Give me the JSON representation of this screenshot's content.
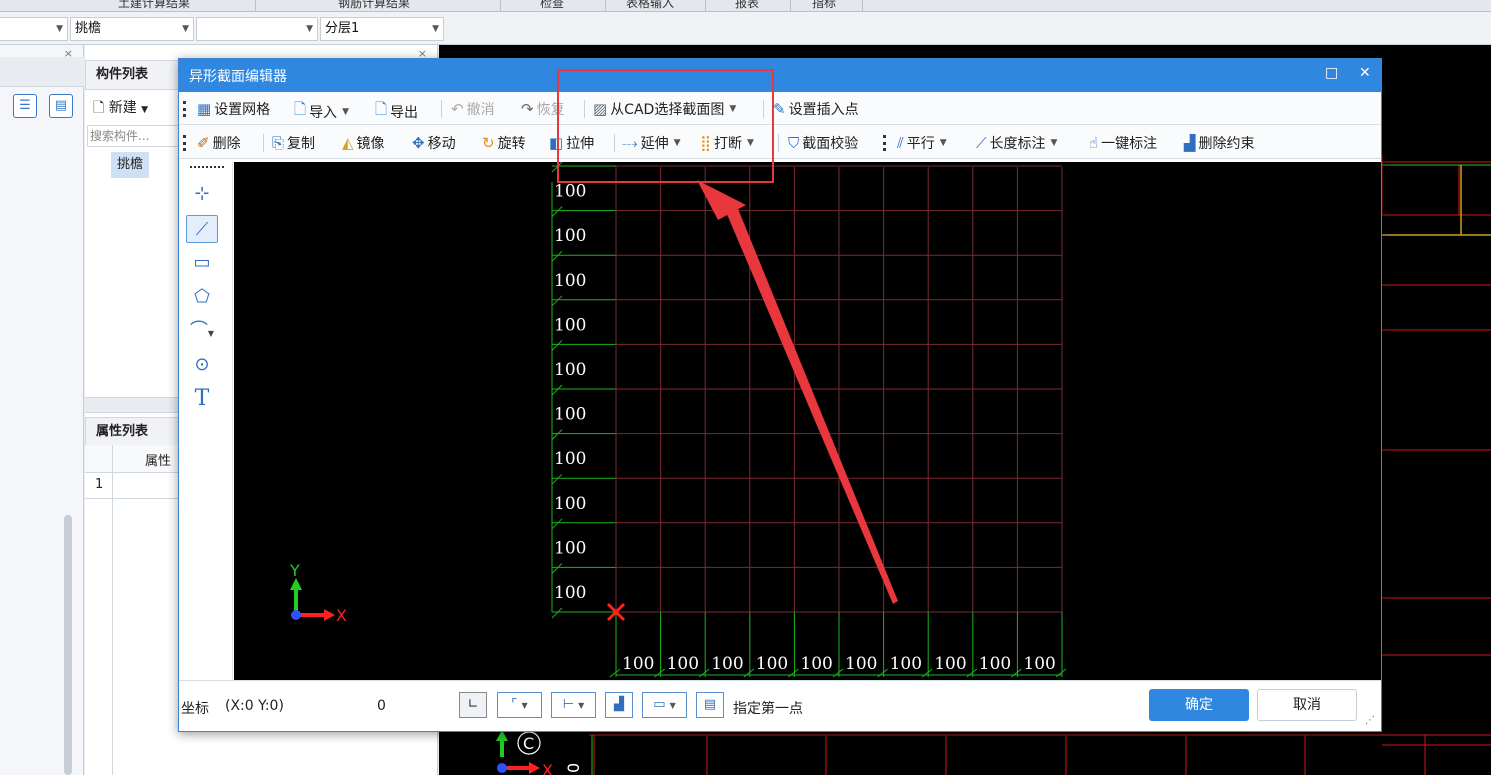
{
  "menubar": {
    "items": [
      "土建计算结果",
      "钢筋计算结果",
      "检查",
      "表格输入",
      "报表",
      "指标"
    ]
  },
  "filterbar": {
    "type_value": "挑檐",
    "blank_value": "",
    "layer_value": "分层1"
  },
  "component_panel": {
    "title": "构件列表",
    "new_label": "新建",
    "search_placeholder": "搜索构件...",
    "selected_item": "挑檐"
  },
  "property_panel": {
    "title": "属性列表",
    "col_header": "属性",
    "row_number": "1"
  },
  "dialog": {
    "title": "异形截面编辑器",
    "toolbar1": {
      "set_grid": "设置网格",
      "import": "导入",
      "export": "导出",
      "undo": "撤消",
      "redo": "恢复",
      "select_from_cad": "从CAD选择截面图",
      "set_insert_point": "设置插入点"
    },
    "toolbar2": {
      "delete": "删除",
      "copy": "复制",
      "mirror": "镜像",
      "move": "移动",
      "rotate": "旋转",
      "stretch": "拉伸",
      "extend": "延伸",
      "break": "打断",
      "check_section": "截面校验",
      "parallel": "平行",
      "length_dim": "长度标注",
      "auto_dim": "一键标注",
      "delete_constraint": "删除约束"
    },
    "draw_tools": {
      "text_tool": "T"
    },
    "canvas": {
      "grid_label": "100",
      "rows": 10,
      "cols": 10,
      "axis_x": "X",
      "axis_y": "Y",
      "grid_color": "#7a2a33",
      "tick_color": "#1bb51b",
      "label_color": "#ffffff",
      "origin_color": "#ff2020"
    },
    "status": {
      "coord_label": "坐标",
      "coord_value": "(X:0 Y:0)",
      "angle_value": "0",
      "hint": "指定第一点",
      "ok": "确定",
      "cancel": "取消"
    }
  },
  "background_cad": {
    "axis_label_c": "C",
    "axis_x": "X",
    "side_text": "0"
  },
  "colors": {
    "accent": "#2f87e0",
    "annotation": "#e8383d"
  }
}
